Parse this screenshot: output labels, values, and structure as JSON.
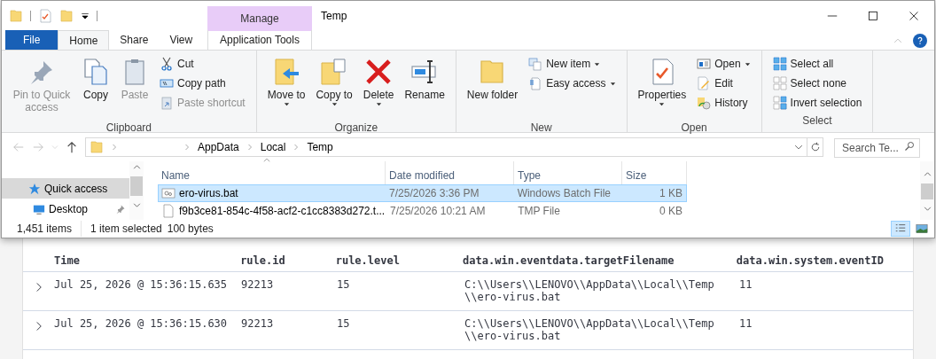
{
  "window": {
    "title": "Temp"
  },
  "contextual_tab_group": {
    "label": "Manage"
  },
  "ribbon_tabs": [
    {
      "label": "File",
      "kind": "file",
      "selected": false
    },
    {
      "label": "Home",
      "kind": "tab",
      "selected": true
    },
    {
      "label": "Share",
      "kind": "tab",
      "selected": false
    },
    {
      "label": "View",
      "kind": "tab",
      "selected": false
    },
    {
      "label": "Application Tools",
      "kind": "contextual",
      "selected": false
    }
  ],
  "ribbon_groups": [
    {
      "title": "Clipboard",
      "commands": [
        {
          "label": "Pin to Quick access",
          "kind": "pin",
          "disabled": true,
          "dropdown": false
        },
        {
          "label": "Copy",
          "kind": "copy",
          "disabled": false,
          "dropdown": false
        },
        {
          "label": "Paste",
          "kind": "paste",
          "disabled": true,
          "dropdown": false
        },
        {
          "label": "Cut",
          "kind": "cut",
          "disabled": false,
          "dropdown": false
        },
        {
          "label": "Copy path",
          "kind": "path",
          "disabled": false,
          "dropdown": false
        },
        {
          "label": "Paste shortcut",
          "kind": "shortcut",
          "disabled": true,
          "dropdown": false
        }
      ]
    },
    {
      "title": "Organize",
      "commands": [
        {
          "label": "Move to",
          "kind": "move",
          "disabled": false,
          "dropdown": true
        },
        {
          "label": "Copy to",
          "kind": "copyto",
          "disabled": false,
          "dropdown": true
        },
        {
          "label": "Delete",
          "kind": "delete",
          "disabled": false,
          "dropdown": true
        },
        {
          "label": "Rename",
          "kind": "rename",
          "disabled": false,
          "dropdown": false
        }
      ]
    },
    {
      "title": "New",
      "commands": [
        {
          "label": "New folder",
          "kind": "folder",
          "disabled": false,
          "dropdown": false
        },
        {
          "label": "New item",
          "kind": "newitem",
          "disabled": false,
          "dropdown": true
        },
        {
          "label": "Easy access",
          "kind": "easy",
          "disabled": false,
          "dropdown": true
        }
      ]
    },
    {
      "title": "Open",
      "commands": [
        {
          "label": "Properties",
          "kind": "properties",
          "disabled": false,
          "dropdown": true
        },
        {
          "label": "Open",
          "kind": "open",
          "disabled": false,
          "dropdown": true
        },
        {
          "label": "Edit",
          "kind": "edit",
          "disabled": false,
          "dropdown": false
        },
        {
          "label": "History",
          "kind": "history",
          "disabled": false,
          "dropdown": false
        }
      ]
    },
    {
      "title": "Select",
      "commands": [
        {
          "label": "Select all",
          "kind": "selall",
          "disabled": false,
          "dropdown": false
        },
        {
          "label": "Select none",
          "kind": "selnone",
          "disabled": false,
          "dropdown": false
        },
        {
          "label": "Invert selection",
          "kind": "selinv",
          "disabled": false,
          "dropdown": false
        }
      ]
    }
  ],
  "address_bar": {
    "path": [
      "AppData",
      "Local",
      "Temp"
    ]
  },
  "search": {
    "placeholder": "Search Te..."
  },
  "navigation_pane": [
    {
      "label": "Quick access",
      "kind": "star",
      "selected": true,
      "pinned": false
    },
    {
      "label": "Desktop",
      "kind": "desktop",
      "selected": false,
      "pinned": true
    }
  ],
  "file_list": {
    "columns": [
      "Name",
      "Date modified",
      "Type",
      "Size"
    ],
    "rows": [
      {
        "name": "ero-virus.bat",
        "kind": "batch",
        "date_modified": "7/25/2026 3:36 PM",
        "type": "Windows Batch File",
        "size": "1 KB",
        "selected": true
      },
      {
        "name": "f9b3ce81-854c-4f58-acf2-c1cc8383d272.t...",
        "kind": "file",
        "date_modified": "7/25/2026 10:21 AM",
        "type": "TMP File",
        "size": "0 KB",
        "selected": false
      }
    ]
  },
  "status_bar": {
    "item_count": "1,451 items",
    "selection": "1 item selected",
    "selection_size": "100 bytes"
  },
  "events_table": {
    "columns": [
      "Time",
      "rule.id",
      "rule.level",
      "data.win.eventdata.targetFilename",
      "data.win.system.eventID"
    ],
    "rows": [
      {
        "time": "Jul 25, 2026 @ 15:36:15.635",
        "rule_id": "92213",
        "rule_level": "15",
        "target_filename": "C:\\\\Users\\\\LENOVO\\\\AppData\\\\Local\\\\Temp\\\\ero-virus.bat",
        "event_id": "11"
      },
      {
        "time": "Jul 25, 2026 @ 15:36:15.630",
        "rule_id": "92213",
        "rule_level": "15",
        "target_filename": "C:\\\\Users\\\\LENOVO\\\\AppData\\\\Local\\\\Temp\\\\ero-virus.bat",
        "event_id": "11"
      }
    ]
  }
}
